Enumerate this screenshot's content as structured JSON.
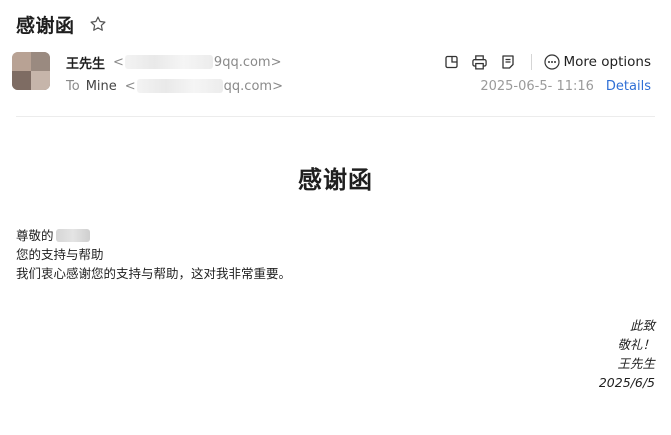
{
  "subject": "感谢函",
  "header": {
    "sender_name": "王先生",
    "sender_addr_prefix": "<",
    "sender_addr_suffix": "9qq.com>",
    "to_label": "To",
    "to_name": "Mine",
    "to_addr_prefix": "<",
    "to_addr_suffix": "qq.com>",
    "date": "2025-06-5- 11:16",
    "details_label": "Details",
    "more_options_label": "More options"
  },
  "body": {
    "title": "感谢函",
    "greeting": "尊敬的",
    "line2": "您的支持与帮助",
    "line3": "我们衷心感谢您的支持与帮助，这对我非常重要。"
  },
  "closing": {
    "line1": "此致",
    "line2": "敬礼！",
    "line3": "王先生",
    "line4": "2025/6/5"
  },
  "colors": {
    "link": "#2f6fd6",
    "muted": "#8a8a8a"
  }
}
